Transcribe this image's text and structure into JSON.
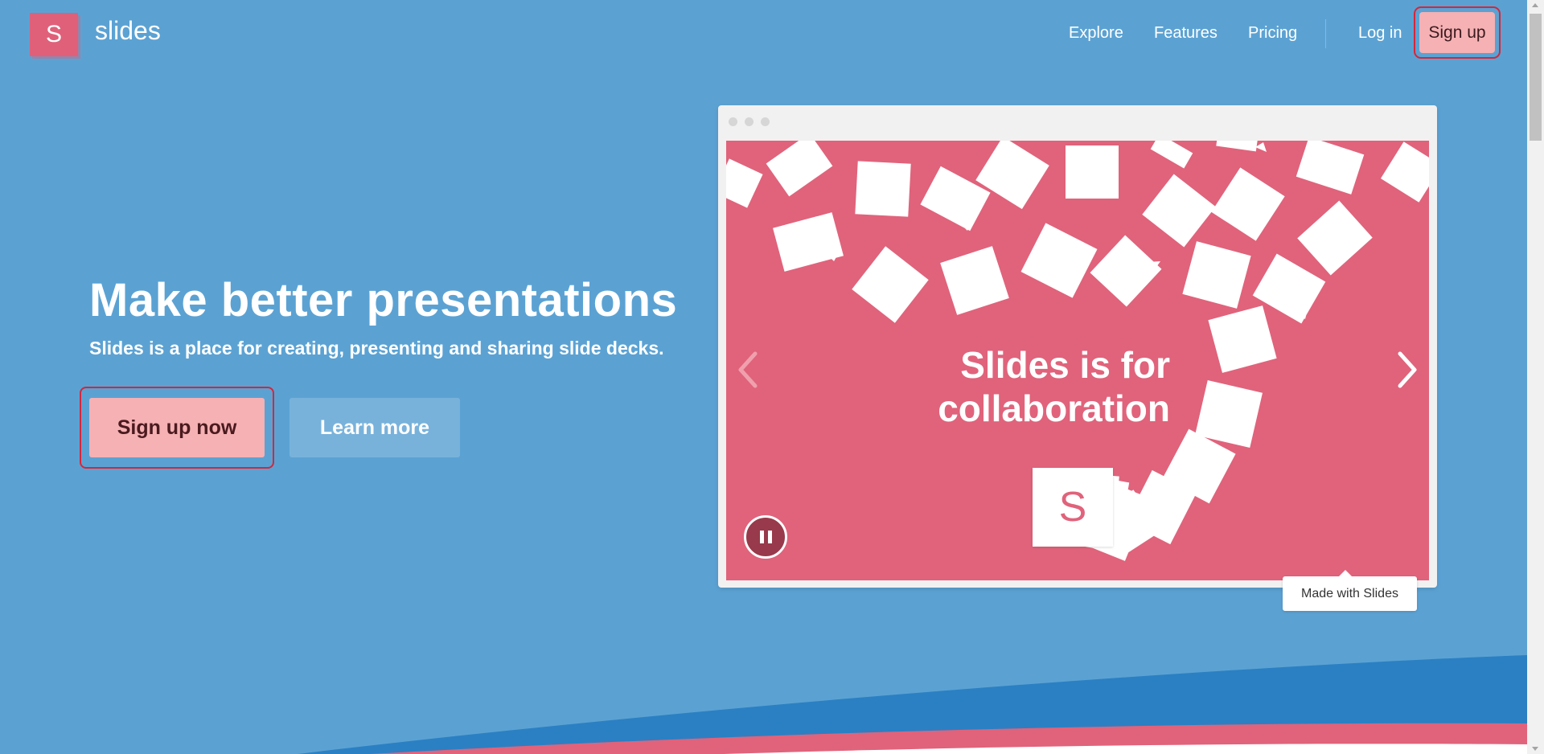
{
  "header": {
    "logo_letter": "S",
    "logo_text": "slides",
    "nav": {
      "explore": "Explore",
      "features": "Features",
      "pricing": "Pricing",
      "login": "Log in",
      "signup": "Sign up"
    }
  },
  "hero": {
    "title": "Make better presentations",
    "subtitle": "Slides is a place for creating, presenting and sharing slide decks.",
    "primary_cta": "Sign up now",
    "secondary_cta": "Learn more"
  },
  "preview": {
    "slide_headline_line1": "Slides is for",
    "slide_headline_line2": "collaboration",
    "card_letter": "S",
    "tooltip": "Made with Slides",
    "icons": {
      "prev": "chevron-left-icon",
      "next": "chevron-right-icon",
      "pause": "pause-icon"
    }
  },
  "colors": {
    "background": "#5ba2d3",
    "accent_pink": "#e0637b",
    "button_pink": "#f5b1b4",
    "highlight_red": "#d6263a",
    "wave_blue": "#2b80c3"
  }
}
